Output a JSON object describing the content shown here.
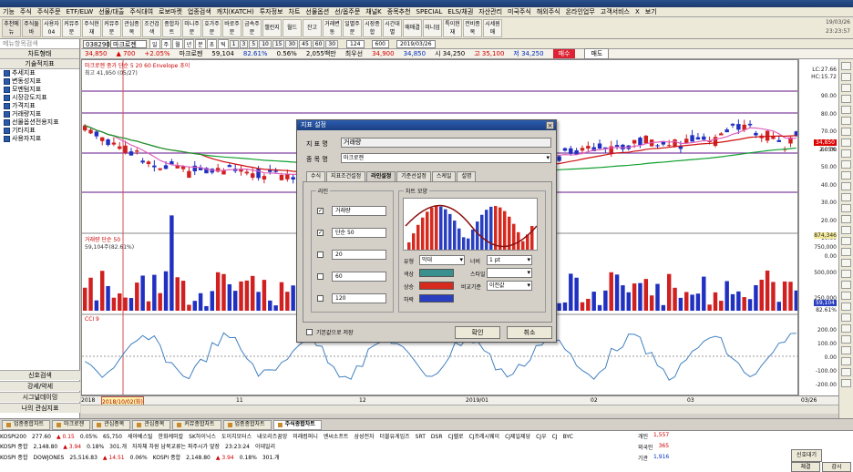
{
  "menu": [
    "기능",
    "주식",
    "주식주문",
    "ETF/ELW",
    "선물/대출",
    "주식대여",
    "로보마켓",
    "업종검색",
    "캐치(KATCH)",
    "투자정보",
    "차트",
    "선물옵션",
    "선/옵주문",
    "채널K",
    "종목추천",
    "SPECIAL",
    "ELS/채권",
    "자산관리",
    "미국주식",
    "해외주식",
    "온라인업무",
    "고객서비스",
    "X",
    "보기"
  ],
  "toolbar": [
    "추천메뉴",
    "주식둘바",
    "사용자04",
    "커뮤주문",
    "주식현재",
    "커뮤주문",
    "관심종목",
    "조건검색",
    "종합차트",
    "미니주문",
    "호가주문",
    "바로주문",
    "금속주문",
    "챌린지",
    "월드",
    "잔고",
    "거래변동",
    "일별주문",
    "시장종합",
    "시간대별",
    "매매결",
    "미니업",
    "특이현재",
    "전비종목",
    "시세원매"
  ],
  "clock": {
    "date": "19/03/26",
    "time": "23:23:57"
  },
  "left": {
    "search_placeholder": "메뉴항목검색",
    "header1": "차트형태",
    "header2": "기술적지표",
    "items": [
      "추세지표",
      "변동성지표",
      "모멘텀지표",
      "시장강도지표",
      "가격지표",
      "거래량지표",
      "선물옵션전용지표",
      "기타지표",
      "사용자지표"
    ],
    "bottom": [
      "신호검색",
      "강세/약세",
      "시그널데이밍",
      "나의 관심지표"
    ]
  },
  "chartbar": {
    "code": "038290",
    "name": "마크로젠",
    "periods": [
      "일",
      "주",
      "월",
      "년",
      "분",
      "초",
      "틱"
    ],
    "intervals": [
      "1",
      "3",
      "5",
      "10",
      "15",
      "30",
      "45",
      "60",
      "30"
    ],
    "count": "124",
    "total": "600",
    "date": "2019/03/26",
    "buy": "매수",
    "sell": "매도"
  },
  "info": {
    "price": "34,850",
    "change": "▲ 700",
    "pct": "+2.05%",
    "name": "마크로젠",
    "volume": "59,104",
    "vol_pct": "82.61%",
    "rate": "0.56%",
    "amount": "2,055백만",
    "low_label": "최우선",
    "bid": "34,900",
    "ask": "34,850",
    "open": "시 34,250",
    "high": "고 35,100",
    "low": "저 34,250"
  },
  "chart": {
    "legend1": "마크로젠  종가 단순 5 20 60  Envelope 초이",
    "hi_label": "최고 41,950 (05/27)",
    "legend2": "거래량  단순 50",
    "legend2b": "59,104주(82.61%)",
    "legend3": "CCI 9",
    "lc": "LC:27.66",
    "hc": "HC:15.72",
    "price_ticks": [
      "90.00",
      "80.00",
      "70.00",
      "60.00",
      "50.00",
      "40.00",
      "30.00",
      "20.00",
      "10.00",
      "0.00"
    ],
    "cur_price": "34,850",
    "cur_pct": "2.05%",
    "vol_ticks": [
      "750,000",
      "500,000",
      "250,000"
    ],
    "vol_max": "874,346",
    "vol_cur": "59,104",
    "vol_pct": "82.61%",
    "cci_ticks": [
      "200.00",
      "100.00",
      "0.00",
      "-100.00",
      "-200.00"
    ],
    "dates": [
      "2018",
      "2018/10/02(화)",
      "11",
      "12",
      "2019/01",
      "02",
      "03",
      "03/26"
    ]
  },
  "dialog": {
    "title": "지표 설정",
    "name_label": "지 표 명",
    "name_value": "거래량",
    "stock_label": "종 목 명",
    "stock_value": "마크로젠",
    "tabs": [
      "수식",
      "지표조건설정",
      "라인설정",
      "기준선설정",
      "스케일",
      "설명"
    ],
    "line_group": "라인",
    "lines": [
      {
        "checked": true,
        "label": "거래량"
      },
      {
        "checked": true,
        "label": "단순 50"
      },
      {
        "checked": false,
        "label": "20"
      },
      {
        "checked": false,
        "label": "60"
      },
      {
        "checked": false,
        "label": "120"
      }
    ],
    "shape_group": "차트 모양",
    "type_label": "유형",
    "type_value": "막대",
    "width_label": "너비",
    "width_value": "1 pt",
    "color_label": "색상",
    "style_label": "스타일",
    "up_label": "상승",
    "down_label": "하락",
    "compare_label": "비교기준",
    "compare_value": "이전값",
    "default_label": "기본값으로 저장",
    "ok": "확인",
    "cancel": "취소",
    "swatch_color": "#3a8f8f",
    "up_color": "#d62a1f",
    "down_color": "#2a3fc0"
  },
  "tabs": [
    "업종종합차트",
    "마크로젠",
    "관심종목",
    "관심종목",
    "커뮤종합차트",
    "업종종합차트",
    "주식종합차트"
  ],
  "ticker": {
    "row1": [
      "KOSPI200",
      "277.60",
      "▲ 0.15",
      "0.05%",
      "65,750",
      "세아베스틸",
      "한화케미칼",
      "SK하이닉스",
      "도이치모터스",
      "내오리즈꿈앙",
      "미래컴퍼니",
      "엔씨소프트",
      "삼성전자",
      "더블유게임즈",
      "SRT",
      "DSR",
      "CJ헬로",
      "CJ프레시웨이",
      "CJ제일제당",
      "CJ우",
      "CJ",
      "BYC"
    ],
    "row2": [
      "KOSPI 종합",
      "2,148.80",
      "▲ 3.94",
      "0.18%",
      "301.개",
      "자자체 차원 남북교류는 파주시가 앞장",
      "23:23:24",
      "이데일리"
    ],
    "row3": [
      "KOSPI 종합",
      "DOWJONES",
      "25,516.83",
      "▲ 14.51",
      "0.06%",
      "KOSPI 종합",
      "2,148.80",
      "▲ 3.94",
      "0.18%",
      "301.개"
    ],
    "stats": {
      "personal_label": "개인",
      "personal": "1,557",
      "foreign_label": "외국인",
      "foreign": "365",
      "inst_label": "기관",
      "inst": "1,916"
    },
    "btn1": "신호대기",
    "btn2": "체결",
    "btn3": "감시"
  }
}
